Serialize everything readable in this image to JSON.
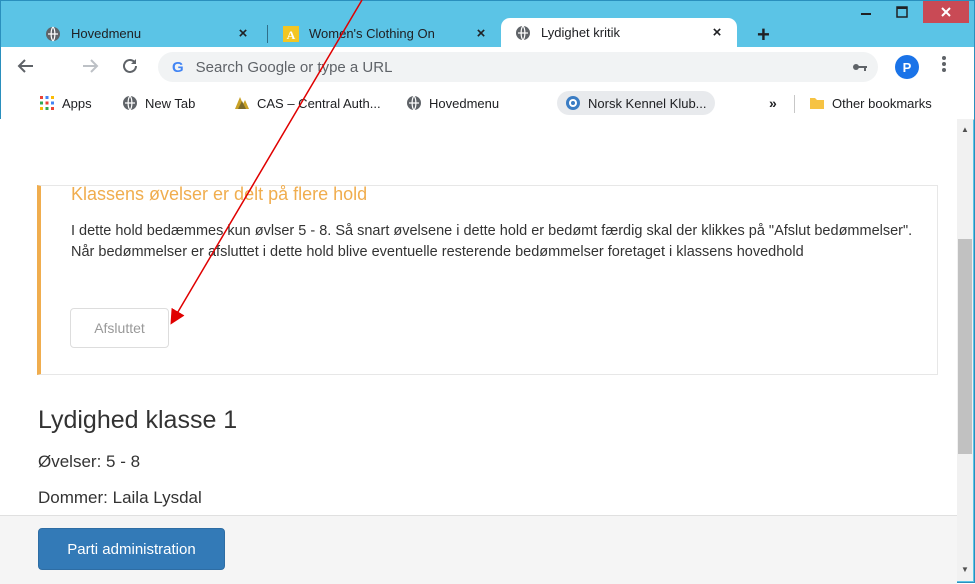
{
  "browser": {
    "tabs": [
      {
        "title": "Hovedmenu",
        "icon": "globe-icon"
      },
      {
        "title": "Women's Clothing On",
        "icon": "amazon-icon"
      },
      {
        "title": "Lydighet kritik",
        "icon": "globe-icon"
      }
    ],
    "new_tab": "+",
    "close_glyph": "×",
    "omnibox": {
      "placeholder": "Search Google or type a URL"
    },
    "profile_initial": "P",
    "bookmarks": [
      {
        "label": "Apps",
        "icon": "apps-icon"
      },
      {
        "label": "New Tab",
        "icon": "globe-icon"
      },
      {
        "label": "CAS – Central Auth...",
        "icon": "cas-icon"
      },
      {
        "label": "Hovedmenu",
        "icon": "globe-icon"
      },
      {
        "label": "Norsk Kennel Klub...",
        "icon": "nkk-icon"
      }
    ],
    "bookmarks_overflow": "»",
    "other_bookmarks": "Other bookmarks"
  },
  "page": {
    "notice": {
      "title": "Klassens øvelser er delt på flere hold",
      "text": "I dette hold bedæmmes kun øvlser 5 - 8. Så snart øvelsene i dette hold er bedømt færdig skal der klikkes på \"Afslut bedømmelser\". Når bedømmelser er afsluttet i dette hold blive eventuelle resterende bedømmelser foretaget i klassens hovedhold",
      "button": "Afsluttet"
    },
    "class_title": "Lydighed klasse 1",
    "exercises": "Øvelser: 5 - 8",
    "judge": "Dommer: Laila Lysdal",
    "primary_button": "Parti administration"
  },
  "colors": {
    "warning": "#f0ad4e",
    "primary": "#337ab7",
    "titlebar": "#5bc4e6",
    "annotation_arrow": "#e00000"
  }
}
